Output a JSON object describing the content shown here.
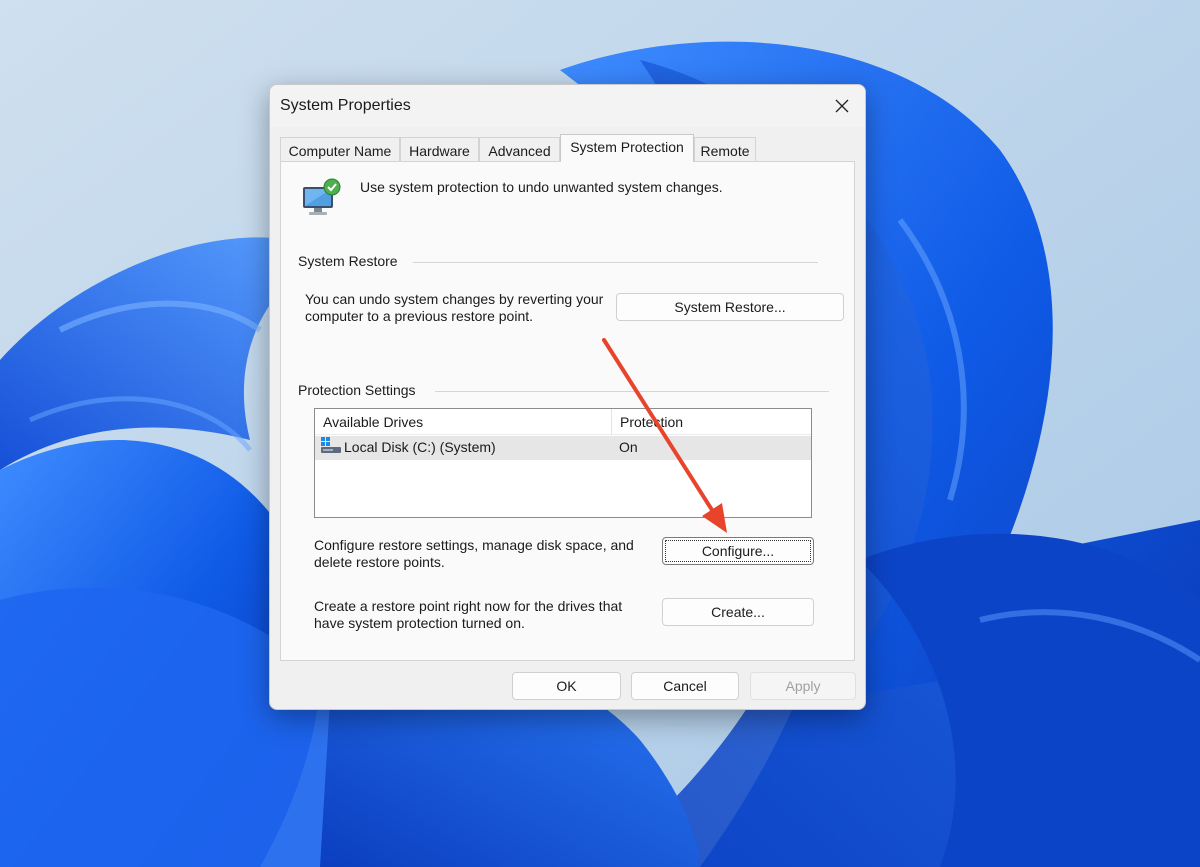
{
  "dialog": {
    "title": "System Properties",
    "tabs": [
      {
        "label": "Computer Name"
      },
      {
        "label": "Hardware"
      },
      {
        "label": "Advanced"
      },
      {
        "label": "System Protection",
        "active": true
      },
      {
        "label": "Remote"
      }
    ],
    "header_text": "Use system protection to undo unwanted system changes.",
    "system_restore": {
      "group_label": "System Restore",
      "description": "You can undo system changes by reverting your computer to a previous restore point.",
      "button_label": "System Restore..."
    },
    "protection_settings": {
      "group_label": "Protection Settings",
      "columns": [
        "Available Drives",
        "Protection"
      ],
      "drives": [
        {
          "name": "Local Disk (C:) (System)",
          "protection": "On"
        }
      ],
      "configure_description": "Configure restore settings, manage disk space, and delete restore points.",
      "configure_label": "Configure...",
      "create_description": "Create a restore point right now for the drives that have system protection turned on.",
      "create_label": "Create..."
    },
    "footer": {
      "ok_label": "OK",
      "cancel_label": "Cancel",
      "apply_label": "Apply"
    }
  },
  "annotation": {
    "arrow_color": "#e8442c"
  },
  "colors": {
    "wallpaper_sky": "#b9d3ea",
    "bloom_blue": "#0a5ae0"
  },
  "icons": {
    "close": "close-icon",
    "header": "system-protection-icon",
    "drive": "drive-icon"
  }
}
